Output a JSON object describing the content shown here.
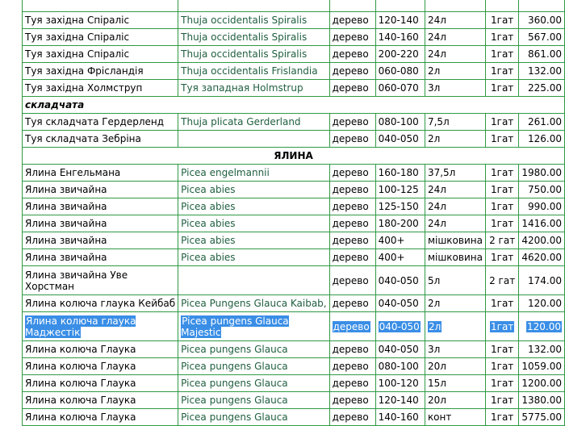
{
  "rows": [
    {
      "kind": "item",
      "name": "",
      "latin": "",
      "form": "",
      "size": "",
      "container": "",
      "grade": "",
      "price": ""
    },
    {
      "kind": "item",
      "name": "Туя західна Спіраліс",
      "latin": "Thuja occidentalis Spiralis",
      "form": "дерево",
      "size": "120-140",
      "container": "24л",
      "grade": "1гат",
      "price": "360.00"
    },
    {
      "kind": "item",
      "name": "Туя західна Спіраліс",
      "latin": "Thuja occidentalis Spiralis",
      "form": "дерево",
      "size": "140-160",
      "container": "24л",
      "grade": "1гат",
      "price": "567.00"
    },
    {
      "kind": "item",
      "name": "Туя західна Спіраліс",
      "latin": "Thuja occidentalis Spiralis",
      "form": "дерево",
      "size": "200-220",
      "container": "24л",
      "grade": "1гат",
      "price": "861.00"
    },
    {
      "kind": "item",
      "name": "Туя західна Фрісландія",
      "latin": "Thuja occidentalis Frislandia",
      "form": "дерево",
      "size": "060-080",
      "container": "2л",
      "grade": "1гат",
      "price": "132.00"
    },
    {
      "kind": "item",
      "name": "Туя західна Холмструп",
      "latin": "Туя западная Holmstrup",
      "form": "дерево",
      "size": "060-070",
      "container": "3л",
      "grade": "1гат",
      "price": "225.00"
    },
    {
      "kind": "subheader",
      "label": "складчата"
    },
    {
      "kind": "item",
      "name": "Туя складчата Гердерленд",
      "latin": "Thuja plicata Gerderland",
      "form": "дерево",
      "size": "080-100",
      "container": "7,5л",
      "grade": "1гат",
      "price": "261.00"
    },
    {
      "kind": "item",
      "name": "Туя складчата Зебріна",
      "latin": "",
      "form": "дерево",
      "size": "040-050",
      "container": "2л",
      "grade": "1гат",
      "price": "126.00"
    },
    {
      "kind": "section",
      "label": "ЯЛИНА"
    },
    {
      "kind": "item",
      "name": "Ялина Енгельмана",
      "latin": "Picea engelmannii",
      "form": "дерево",
      "size": "160-180",
      "container": "37,5л",
      "grade": "1гат",
      "price": "1980.00"
    },
    {
      "kind": "item",
      "name": "Ялина звичайна",
      "latin": "Picea abies",
      "form": "дерево",
      "size": "100-125",
      "container": "24л",
      "grade": "1гат",
      "price": "750.00"
    },
    {
      "kind": "item",
      "name": "Ялина звичайна",
      "latin": "Picea abies",
      "form": "дерево",
      "size": "125-150",
      "container": "24л",
      "grade": "1гат",
      "price": "990.00"
    },
    {
      "kind": "item",
      "name": "Ялина звичайна",
      "latin": "Picea abies",
      "form": "дерево",
      "size": "180-200",
      "container": "24л",
      "grade": "1гат",
      "price": "1416.00"
    },
    {
      "kind": "item",
      "name": "Ялина звичайна",
      "latin": "Picea abies",
      "form": "дерево",
      "size": "400+",
      "container": "мішковина",
      "grade": "2 гат",
      "price": "4200.00"
    },
    {
      "kind": "item",
      "name": "Ялина звичайна",
      "latin": "Picea abies",
      "form": "дерево",
      "size": "400+",
      "container": "мішковина",
      "grade": "1гат",
      "price": "4620.00"
    },
    {
      "kind": "item",
      "tall": true,
      "name": "Ялина звичайна Уве Хорстман",
      "latin": "",
      "form": "дерево",
      "size": "040-050",
      "container": "5л",
      "grade": "2 гат",
      "price": "174.00"
    },
    {
      "kind": "item",
      "name": "Ялина колюча глаука Кейбаб",
      "latin": "Picea Pungens Glauca Kaibab,",
      "form": "дерево",
      "size": "040-050",
      "container": "2л",
      "grade": "1гат",
      "price": "120.00"
    },
    {
      "kind": "item",
      "tall": true,
      "selected": true,
      "name": "Ялина колюча глаука Маджестік",
      "latin": "Picea pungens Glauca Majestic",
      "form": "дерево",
      "size": "040-050",
      "container": "2л",
      "grade": "1гат",
      "price": "120.00"
    },
    {
      "kind": "item",
      "name": "Ялина колюча Глаука",
      "latin": "Picea pungens Glauca",
      "form": "дерево",
      "size": "040-050",
      "container": "3л",
      "grade": "1гат",
      "price": "132.00"
    },
    {
      "kind": "item",
      "name": "Ялина колюча Глаука",
      "latin": "Picea pungens Glauca",
      "form": "дерево",
      "size": "080-100",
      "container": "20л",
      "grade": "1гат",
      "price": "1059.00"
    },
    {
      "kind": "item",
      "name": "Ялина колюча Глаука",
      "latin": "Picea pungens Glauca",
      "form": "дерево",
      "size": "100-120",
      "container": "15л",
      "grade": "1гат",
      "price": "1200.00"
    },
    {
      "kind": "item",
      "name": "Ялина колюча Глаука",
      "latin": "Picea pungens Glauca",
      "form": "дерево",
      "size": "120-140",
      "container": "20л",
      "grade": "1гат",
      "price": "1380.00"
    },
    {
      "kind": "item",
      "name": "Ялина колюча Глаука",
      "latin": "Picea pungens Glauca",
      "form": "дерево",
      "size": "140-160",
      "container": "конт",
      "grade": "1гат",
      "price": "5775.00"
    }
  ]
}
